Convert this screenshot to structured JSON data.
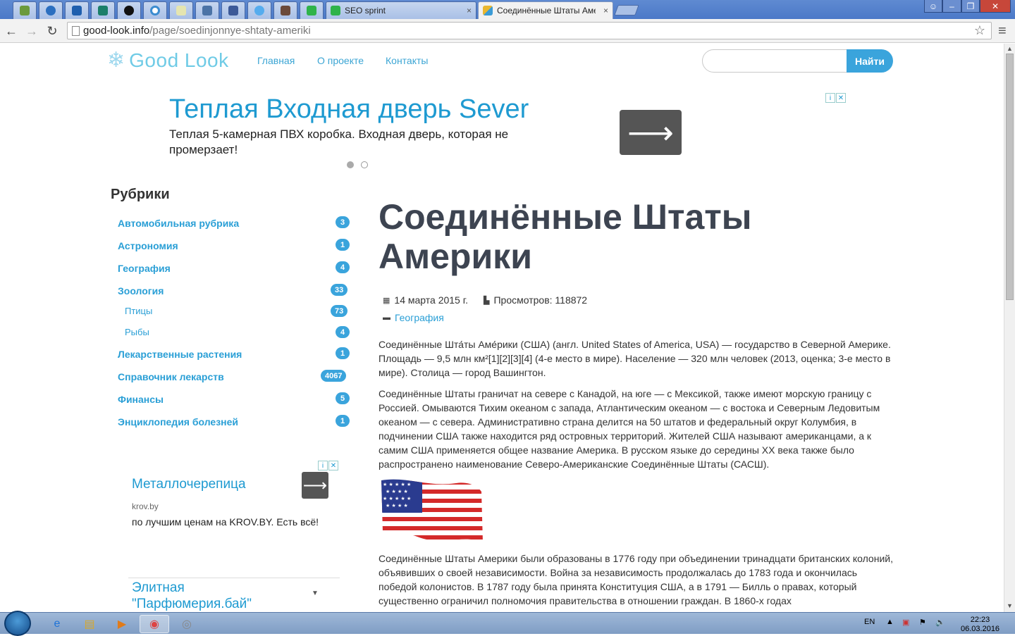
{
  "browser": {
    "tabs": [
      {
        "label": "SEO sprint",
        "icon": "dollar-tab-icon",
        "color": "#2fb34a"
      },
      {
        "label": "Соединённые Штаты Аме",
        "icon": "goodlook-tab-icon",
        "color": "#e9b730"
      }
    ],
    "url_host": "good-look.info",
    "url_path": "/page/soedinjonnye-shtaty-ameriki",
    "tab_close": "×"
  },
  "site": {
    "logo": "Good Look",
    "nav": [
      "Главная",
      "О проекте",
      "Контакты"
    ],
    "search_button": "Найти"
  },
  "ad_top": {
    "title": "Теплая Входная дверь Sever",
    "text": "Теплая 5-камерная ПВХ коробка. Входная дверь, которая не промерзает!",
    "arrow": "⟶"
  },
  "sidebar": {
    "heading": "Рубрики",
    "items": [
      {
        "label": "Автомобильная рубрика",
        "count": "3"
      },
      {
        "label": "Астрономия",
        "count": "1"
      },
      {
        "label": "География",
        "count": "4"
      },
      {
        "label": "Зоология",
        "count": "33"
      },
      {
        "label": "Птицы",
        "count": "73"
      },
      {
        "label": "Рыбы",
        "count": "4"
      },
      {
        "label": "Лекарственные растения",
        "count": "1"
      },
      {
        "label": "Справочник лекарств",
        "count": "4067"
      },
      {
        "label": "Финансы",
        "count": "5"
      },
      {
        "label": "Энциклопедия болезней",
        "count": "1"
      }
    ]
  },
  "ad_side": {
    "title": "Металлочерепица",
    "domain": "krov.by",
    "text": "по лучшим ценам на KROV.BY. Есть всё!",
    "dropdown": "Элитная \"Парфюмерия.бай\""
  },
  "article": {
    "title": "Соединённые Штаты Америки",
    "date": "14 марта 2015 г.",
    "views": "Просмотров: 118872",
    "category": "География",
    "p1": "Соединённые Шта́ты Аме́рики (США) (англ. United States of America, USA) — государство в Северной Америке. Площадь — 9,5 млн км²[1][2][3][4] (4-е место в мире). Население — 320 млн человек (2013, оценка; 3-е место в мире). Столица — город Вашингтон.",
    "p2": "Соединённые Штаты граничат на севере с Канадой, на юге — с Мексикой, также имеют морскую границу с Россией. Омываются Тихим океаном с запада, Атлантическим океаном — с востока и Северным Ледовитым океаном — с севера. Административно страна делится на 50 штатов и федеральный округ Колумбия, в подчинении США также находится ряд островных территорий. Жителей США называют американцами, а к самим США применяется общее название Америка. В русском языке до середины XX века также было распространено наименование Северо-Американские Соединённые Штаты (САСШ).",
    "p3": "Соединённые Штаты Америки были образованы в 1776 году при объединении тринадцати британских колоний, объявивших о своей независимости. Война за независимость продолжалась до 1783 года и окончилась победой колонистов. В 1787 году была принята Конституция США, а в 1791 — Билль о правах, который существенно ограничил полномочия правительства в отношении граждан. В 1860-х годах"
  },
  "taskbar": {
    "lang": "EN",
    "time": "22:23",
    "date": "06.03.2016"
  }
}
